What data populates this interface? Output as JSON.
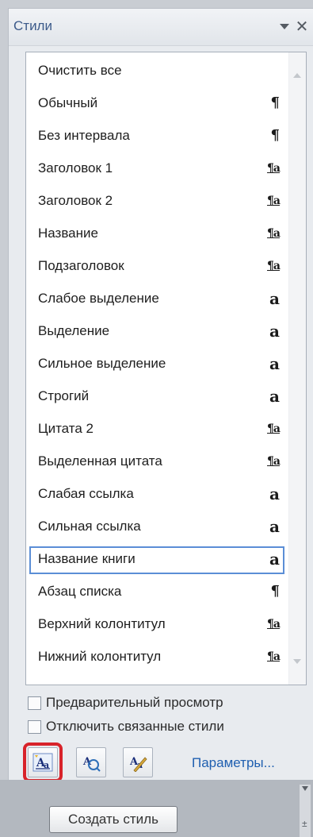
{
  "pane": {
    "title": "Стили"
  },
  "styles": [
    {
      "label": "Очистить все",
      "icon": "none",
      "glyph": ""
    },
    {
      "label": "Обычный",
      "icon": "paragraph-style-icon",
      "glyph": "¶"
    },
    {
      "label": "Без интервала",
      "icon": "paragraph-style-icon",
      "glyph": "¶"
    },
    {
      "label": "Заголовок 1",
      "icon": "linked-style-icon",
      "glyph": "¶a"
    },
    {
      "label": "Заголовок 2",
      "icon": "linked-style-icon",
      "glyph": "¶a"
    },
    {
      "label": "Название",
      "icon": "linked-style-icon",
      "glyph": "¶a"
    },
    {
      "label": "Подзаголовок",
      "icon": "linked-style-icon",
      "glyph": "¶a"
    },
    {
      "label": "Слабое выделение",
      "icon": "character-style-icon",
      "glyph": "a"
    },
    {
      "label": "Выделение",
      "icon": "character-style-icon",
      "glyph": "a"
    },
    {
      "label": "Сильное выделение",
      "icon": "character-style-icon",
      "glyph": "a"
    },
    {
      "label": "Строгий",
      "icon": "character-style-icon",
      "glyph": "a"
    },
    {
      "label": "Цитата 2",
      "icon": "linked-style-icon",
      "glyph": "¶a"
    },
    {
      "label": "Выделенная цитата",
      "icon": "linked-style-icon",
      "glyph": "¶a"
    },
    {
      "label": "Слабая ссылка",
      "icon": "character-style-icon",
      "glyph": "a"
    },
    {
      "label": "Сильная ссылка",
      "icon": "character-style-icon",
      "glyph": "a"
    },
    {
      "label": "Название книги",
      "icon": "character-style-icon",
      "glyph": "a",
      "selected": true
    },
    {
      "label": "Абзац списка",
      "icon": "paragraph-style-icon",
      "glyph": "¶"
    },
    {
      "label": "Верхний колонтитул",
      "icon": "linked-style-icon",
      "glyph": "¶a"
    },
    {
      "label": "Нижний колонтитул",
      "icon": "linked-style-icon",
      "glyph": "¶a"
    }
  ],
  "options": {
    "preview_label": "Предварительный просмотр",
    "preview_checked": false,
    "disable_linked_label": "Отключить связанные стили",
    "disable_linked_checked": false
  },
  "toolbar": {
    "new_style_icon": "new-style-icon",
    "style_inspector_icon": "style-inspector-icon",
    "manage_styles_icon": "manage-styles-icon",
    "params_label": "Параметры..."
  },
  "tooltip": {
    "text": "Создать стиль"
  },
  "colors": {
    "highlight": "#d8232a",
    "selection": "#5b8ed6",
    "link": "#1f5fb0",
    "title": "#3c5a8a"
  }
}
